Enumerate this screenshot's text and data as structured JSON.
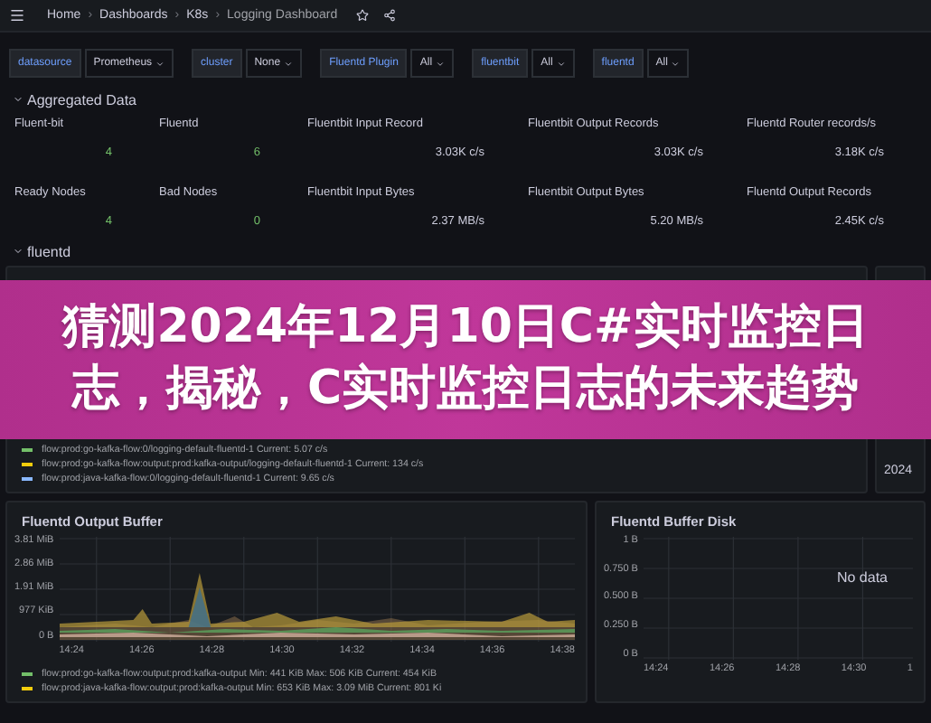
{
  "breadcrumb": [
    "Home",
    "Dashboards",
    "K8s",
    "Logging Dashboard"
  ],
  "breadcrumb_separator": "›",
  "variables": [
    {
      "label": "datasource",
      "value": "Prometheus"
    },
    {
      "label": "cluster",
      "value": "None"
    },
    {
      "label": "Fluentd Plugin",
      "value": "All"
    },
    {
      "label": "fluentbit",
      "value": "All"
    },
    {
      "label": "fluentd",
      "value": "All"
    }
  ],
  "sections": [
    {
      "title": "Aggregated Data",
      "expanded": true
    },
    {
      "title": "fluentd",
      "expanded": true
    }
  ],
  "stats": [
    {
      "title": "Fluent-bit",
      "value": "4",
      "kind": "count"
    },
    {
      "title": "Fluentd",
      "value": "6",
      "kind": "count"
    },
    {
      "title": "Fluentbit Input Record",
      "value": "3.03K c/s",
      "kind": "rate"
    },
    {
      "title": "Fluentbit Output Records",
      "value": "3.03K c/s",
      "kind": "rate"
    },
    {
      "title": "Fluentd Router records/s",
      "value": "3.18K c/s",
      "kind": "rate"
    },
    {
      "title": "Ready Nodes",
      "value": "4",
      "kind": "count"
    },
    {
      "title": "Bad Nodes",
      "value": "0",
      "kind": "count"
    },
    {
      "title": "Fluentbit Input Bytes",
      "value": "2.37 MB/s",
      "kind": "rate"
    },
    {
      "title": "Fluentbit Output Bytes",
      "value": "5.20 MB/s",
      "kind": "rate"
    },
    {
      "title": "Fluentd Output Records",
      "value": "2.45K c/s",
      "kind": "rate"
    }
  ],
  "banner": {
    "title": "猜测2024年12月10日C#实时监控日志，揭秘，C实时监控日志的未来趋势"
  },
  "router_panel": {
    "legend": [
      {
        "series": "flow:prod:go-kafka-flow:0/logging-default-fluentd-1",
        "stats": "Current: 5.07 c/s",
        "color": "#73bf69"
      },
      {
        "series": "flow:prod:go-kafka-flow:output:prod:kafka-output/logging-default-fluentd-1",
        "stats": "Current: 134 c/s",
        "color": "#f2cc0c"
      },
      {
        "series": "flow:prod:java-kafka-flow:0/logging-default-fluentd-1",
        "stats": "Current: 9.65 c/s",
        "color": "#8ab8ff"
      }
    ]
  },
  "side_panel": {
    "rows": [
      "2024"
    ]
  },
  "output_buffer": {
    "title": "Fluentd Output Buffer",
    "yticks": [
      "3.81 MiB",
      "2.86 MiB",
      "1.91 MiB",
      "977 KiB",
      "0 B"
    ],
    "xticks": [
      "14:24",
      "14:26",
      "14:28",
      "14:30",
      "14:32",
      "14:34",
      "14:36",
      "14:38"
    ],
    "legend": [
      {
        "series": "flow:prod:go-kafka-flow:output:prod:kafka-output",
        "stats": "Min: 441 KiB  Max: 506 KiB  Current: 454 KiB",
        "color": "#73bf69"
      },
      {
        "series": "flow:prod:java-kafka-flow:output:prod:kafka-output",
        "stats": "Min: 653 KiB  Max: 3.09 MiB  Current: 801 Ki",
        "color": "#f2cc0c"
      }
    ]
  },
  "buffer_disk": {
    "title": "Fluentd Buffer Disk",
    "yticks": [
      "1 B",
      "0.750 B",
      "0.500 B",
      "0.250 B",
      "0 B"
    ],
    "xticks": [
      "14:24",
      "14:26",
      "14:28",
      "14:30",
      "1"
    ],
    "message": "No data"
  }
}
